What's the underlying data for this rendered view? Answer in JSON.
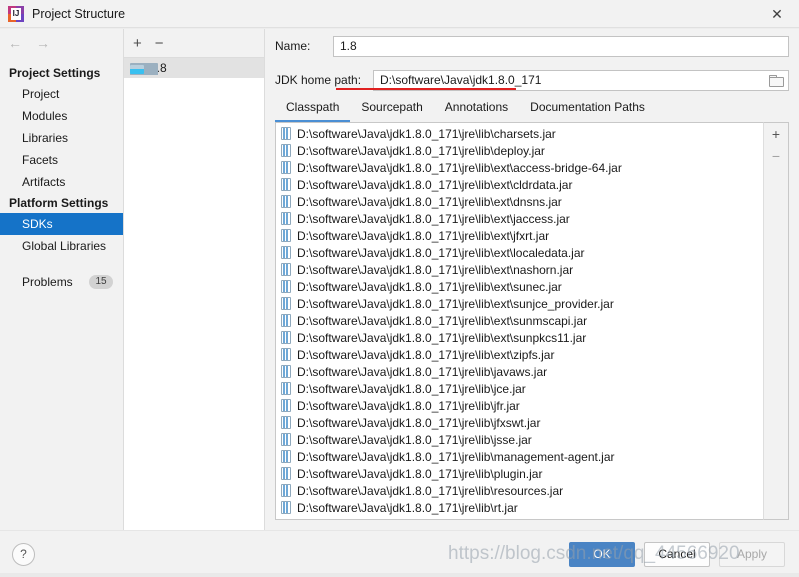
{
  "window": {
    "title": "Project Structure",
    "app_icon": "intellij-idea-icon",
    "close_label": "✕"
  },
  "nav": {
    "back": "←",
    "forward": "→"
  },
  "sidebar": {
    "groups": [
      {
        "title": "Project Settings",
        "items": [
          {
            "label": "Project",
            "selected": false
          },
          {
            "label": "Modules",
            "selected": false
          },
          {
            "label": "Libraries",
            "selected": false
          },
          {
            "label": "Facets",
            "selected": false
          },
          {
            "label": "Artifacts",
            "selected": false
          }
        ]
      },
      {
        "title": "Platform Settings",
        "items": [
          {
            "label": "SDKs",
            "selected": true
          },
          {
            "label": "Global Libraries",
            "selected": false
          }
        ]
      }
    ],
    "problems": {
      "label": "Problems",
      "count": "15"
    }
  },
  "sdk_panel": {
    "add_label": "+",
    "remove_label": "−",
    "items": [
      {
        "label": "1.8",
        "selected": true
      }
    ]
  },
  "detail": {
    "name_label": "Name:",
    "name_value": "1.8",
    "path_label": "JDK home path:",
    "path_value": "D:\\software\\Java\\jdk1.8.0_171",
    "browse_icon": "folder-browse-icon",
    "tabs": [
      {
        "label": "Classpath",
        "active": true
      },
      {
        "label": "Sourcepath",
        "active": false
      },
      {
        "label": "Annotations",
        "active": false
      },
      {
        "label": "Documentation Paths",
        "active": false
      }
    ],
    "classpath_add": "+",
    "classpath_remove": "−",
    "classpath": [
      "D:\\software\\Java\\jdk1.8.0_171\\jre\\lib\\charsets.jar",
      "D:\\software\\Java\\jdk1.8.0_171\\jre\\lib\\deploy.jar",
      "D:\\software\\Java\\jdk1.8.0_171\\jre\\lib\\ext\\access-bridge-64.jar",
      "D:\\software\\Java\\jdk1.8.0_171\\jre\\lib\\ext\\cldrdata.jar",
      "D:\\software\\Java\\jdk1.8.0_171\\jre\\lib\\ext\\dnsns.jar",
      "D:\\software\\Java\\jdk1.8.0_171\\jre\\lib\\ext\\jaccess.jar",
      "D:\\software\\Java\\jdk1.8.0_171\\jre\\lib\\ext\\jfxrt.jar",
      "D:\\software\\Java\\jdk1.8.0_171\\jre\\lib\\ext\\localedata.jar",
      "D:\\software\\Java\\jdk1.8.0_171\\jre\\lib\\ext\\nashorn.jar",
      "D:\\software\\Java\\jdk1.8.0_171\\jre\\lib\\ext\\sunec.jar",
      "D:\\software\\Java\\jdk1.8.0_171\\jre\\lib\\ext\\sunjce_provider.jar",
      "D:\\software\\Java\\jdk1.8.0_171\\jre\\lib\\ext\\sunmscapi.jar",
      "D:\\software\\Java\\jdk1.8.0_171\\jre\\lib\\ext\\sunpkcs11.jar",
      "D:\\software\\Java\\jdk1.8.0_171\\jre\\lib\\ext\\zipfs.jar",
      "D:\\software\\Java\\jdk1.8.0_171\\jre\\lib\\javaws.jar",
      "D:\\software\\Java\\jdk1.8.0_171\\jre\\lib\\jce.jar",
      "D:\\software\\Java\\jdk1.8.0_171\\jre\\lib\\jfr.jar",
      "D:\\software\\Java\\jdk1.8.0_171\\jre\\lib\\jfxswt.jar",
      "D:\\software\\Java\\jdk1.8.0_171\\jre\\lib\\jsse.jar",
      "D:\\software\\Java\\jdk1.8.0_171\\jre\\lib\\management-agent.jar",
      "D:\\software\\Java\\jdk1.8.0_171\\jre\\lib\\plugin.jar",
      "D:\\software\\Java\\jdk1.8.0_171\\jre\\lib\\resources.jar",
      "D:\\software\\Java\\jdk1.8.0_171\\jre\\lib\\rt.jar"
    ]
  },
  "footer": {
    "help_label": "?",
    "ok_label": "OK",
    "cancel_label": "Cancel",
    "apply_label": "Apply"
  },
  "overlay": {
    "watermark": "https://blog.csdn.net/qq_44566920",
    "red_underline_color": "#e02020"
  }
}
